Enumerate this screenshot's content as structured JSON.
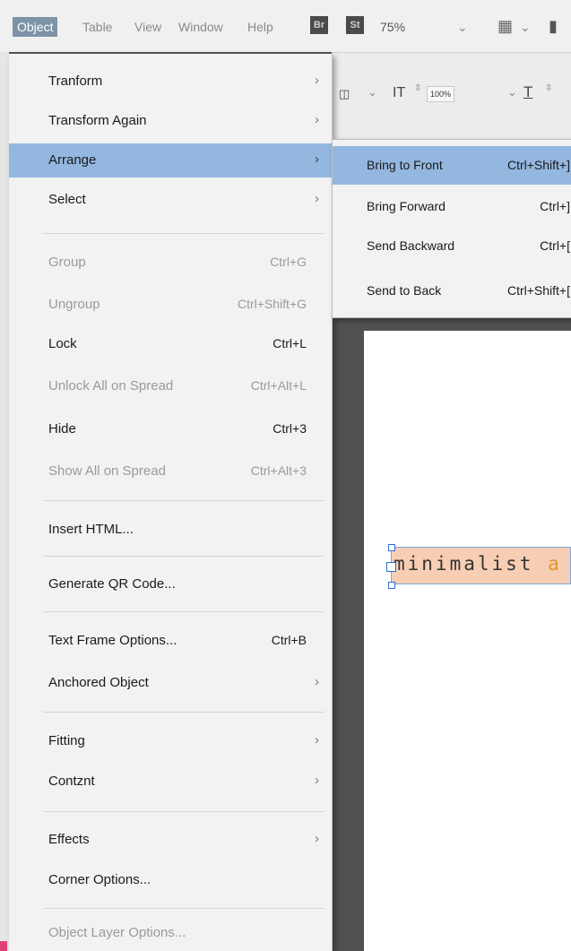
{
  "menubar": {
    "items": [
      {
        "label": "Object",
        "active": true
      },
      {
        "label": "Table"
      },
      {
        "label": "View"
      },
      {
        "label": "Window"
      },
      {
        "label": "Help"
      }
    ],
    "app_badges": [
      "Br",
      "St"
    ],
    "zoom": "75%"
  },
  "control_panel": {
    "font_size_prefix": "IT",
    "scale": "100%",
    "tracking_prefix": "T"
  },
  "object_menu": {
    "items": [
      {
        "label": "Tranform",
        "shortcut": "",
        "submenu": true,
        "enabled": true
      },
      {
        "label": "Transform Again",
        "shortcut": "",
        "submenu": true,
        "enabled": true
      },
      {
        "label": "Arrange",
        "shortcut": "",
        "submenu": true,
        "enabled": true,
        "highlighted": true
      },
      {
        "label": "Select",
        "shortcut": "",
        "submenu": true,
        "enabled": true
      },
      {
        "label": "Group",
        "shortcut": "Ctrl+G",
        "submenu": false,
        "enabled": false
      },
      {
        "label": "Ungroup",
        "shortcut": "Ctrl+Shift+G",
        "submenu": false,
        "enabled": false
      },
      {
        "label": "Lock",
        "shortcut": "Ctrl+L",
        "submenu": false,
        "enabled": true
      },
      {
        "label": "Unlock All on Spread",
        "shortcut": "Ctrl+Alt+L",
        "submenu": false,
        "enabled": false
      },
      {
        "label": "Hide",
        "shortcut": "Ctrl+3",
        "submenu": false,
        "enabled": true
      },
      {
        "label": "Show All on Spread",
        "shortcut": "Ctrl+Alt+3",
        "submenu": false,
        "enabled": false
      },
      {
        "label": "Insert HTML...",
        "shortcut": "",
        "submenu": false,
        "enabled": true
      },
      {
        "label": "Generate QR Code...",
        "shortcut": "",
        "submenu": false,
        "enabled": true
      },
      {
        "label": "Text Frame Options...",
        "shortcut": "Ctrl+B",
        "submenu": false,
        "enabled": true
      },
      {
        "label": "Anchored Object",
        "shortcut": "",
        "submenu": true,
        "enabled": true
      },
      {
        "label": "Fitting",
        "shortcut": "",
        "submenu": true,
        "enabled": true
      },
      {
        "label": "Contznt",
        "shortcut": "",
        "submenu": true,
        "enabled": true
      },
      {
        "label": "Effects",
        "shortcut": "",
        "submenu": true,
        "enabled": true
      },
      {
        "label": "Corner Options...",
        "shortcut": "",
        "submenu": false,
        "enabled": true
      },
      {
        "label": "Object Layer Options...",
        "shortcut": "",
        "submenu": false,
        "enabled": false
      }
    ]
  },
  "arrange_submenu": {
    "items": [
      {
        "label": "Bring to Front",
        "shortcut": "Ctrl+Shift+]",
        "highlighted": true
      },
      {
        "label": "Bring Forward",
        "shortcut": "Ctrl+]"
      },
      {
        "label": "Send Backward",
        "shortcut": "Ctrl+["
      },
      {
        "label": "Send to Back",
        "shortcut": "Ctrl+Shift+["
      }
    ]
  },
  "document": {
    "frame_text": "minimalist",
    "frame_text_overflow": "a"
  },
  "colors": {
    "menu_highlight": "#94b7e0",
    "text_frame_fill": "#f7cdb3",
    "overflow_text": "#e0962a"
  }
}
